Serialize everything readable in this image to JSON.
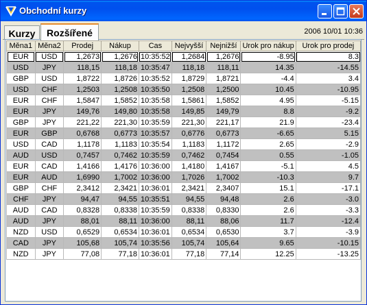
{
  "window": {
    "title": "Obchodní kurzy"
  },
  "tabs": [
    {
      "label": "Kurzy"
    },
    {
      "label": "Rozšířené"
    }
  ],
  "datetime": "2006 10/01 10:36",
  "table": {
    "headers": [
      "Měna1",
      "Měna2",
      "Prodej",
      "Nákup",
      "Cas",
      "Nejvyšší",
      "Nejnižší",
      "Urok pro nákup",
      "Urok pro prodej"
    ],
    "rows": [
      [
        "EUR",
        "USD",
        "1,2673",
        "1,2676",
        "10:35:52",
        "1,2684",
        "1,2676",
        "-8.95",
        "8.3"
      ],
      [
        "USD",
        "JPY",
        "118,15",
        "118,18",
        "10:35:47",
        "118,18",
        "118,11",
        "14.35",
        "-14.55"
      ],
      [
        "GBP",
        "USD",
        "1,8722",
        "1,8726",
        "10:35:52",
        "1,8729",
        "1,8721",
        "-4.4",
        "3.4"
      ],
      [
        "USD",
        "CHF",
        "1,2503",
        "1,2508",
        "10:35:50",
        "1,2508",
        "1,2500",
        "10.45",
        "-10.95"
      ],
      [
        "EUR",
        "CHF",
        "1,5847",
        "1,5852",
        "10:35:58",
        "1,5861",
        "1,5852",
        "4.95",
        "-5.15"
      ],
      [
        "EUR",
        "JPY",
        "149,76",
        "149,80",
        "10:35:58",
        "149,85",
        "149,79",
        "8.8",
        "-9.2"
      ],
      [
        "GBP",
        "JPY",
        "221,22",
        "221,30",
        "10:35:59",
        "221,30",
        "221,17",
        "21.9",
        "-23.4"
      ],
      [
        "EUR",
        "GBP",
        "0,6768",
        "0,6773",
        "10:35:57",
        "0,6776",
        "0,6773",
        "-6.65",
        "5.15"
      ],
      [
        "USD",
        "CAD",
        "1,1178",
        "1,1183",
        "10:35:54",
        "1,1183",
        "1,1172",
        "2.65",
        "-2.9"
      ],
      [
        "AUD",
        "USD",
        "0,7457",
        "0,7462",
        "10:35:59",
        "0,7462",
        "0,7454",
        "0.55",
        "-1.05"
      ],
      [
        "EUR",
        "CAD",
        "1,4166",
        "1,4176",
        "10:36:00",
        "1,4180",
        "1,4167",
        "-5.1",
        "4.5"
      ],
      [
        "EUR",
        "AUD",
        "1,6990",
        "1,7002",
        "10:36:00",
        "1,7026",
        "1,7002",
        "-10.3",
        "9.7"
      ],
      [
        "GBP",
        "CHF",
        "2,3412",
        "2,3421",
        "10:36:01",
        "2,3421",
        "2,3407",
        "15.1",
        "-17.1"
      ],
      [
        "CHF",
        "JPY",
        "94,47",
        "94,55",
        "10:35:51",
        "94,55",
        "94,48",
        "2.6",
        "-3.0"
      ],
      [
        "AUD",
        "CAD",
        "0,8328",
        "0,8338",
        "10:35:59",
        "0,8338",
        "0,8330",
        "2.6",
        "-3.3"
      ],
      [
        "AUD",
        "JPY",
        "88,01",
        "88,11",
        "10:36:00",
        "88,11",
        "88,06",
        "11.7",
        "-12.4"
      ],
      [
        "NZD",
        "USD",
        "0,6529",
        "0,6534",
        "10:36:01",
        "0,6534",
        "0,6530",
        "3.7",
        "-3.9"
      ],
      [
        "CAD",
        "JPY",
        "105,68",
        "105,74",
        "10:35:56",
        "105,74",
        "105,64",
        "9.65",
        "-10.15"
      ],
      [
        "NZD",
        "JPY",
        "77,08",
        "77,18",
        "10:36:01",
        "77,18",
        "77,14",
        "12.25",
        "-13.25"
      ]
    ]
  },
  "colors": {
    "titlebar": "#0054e3",
    "row_alt": "#c0c0c0",
    "active_tab_accent": "#e68b2c"
  },
  "icons": {
    "app": "forex-chart-icon",
    "minimize": "minimize-icon",
    "maximize": "maximize-icon",
    "close": "close-icon"
  }
}
